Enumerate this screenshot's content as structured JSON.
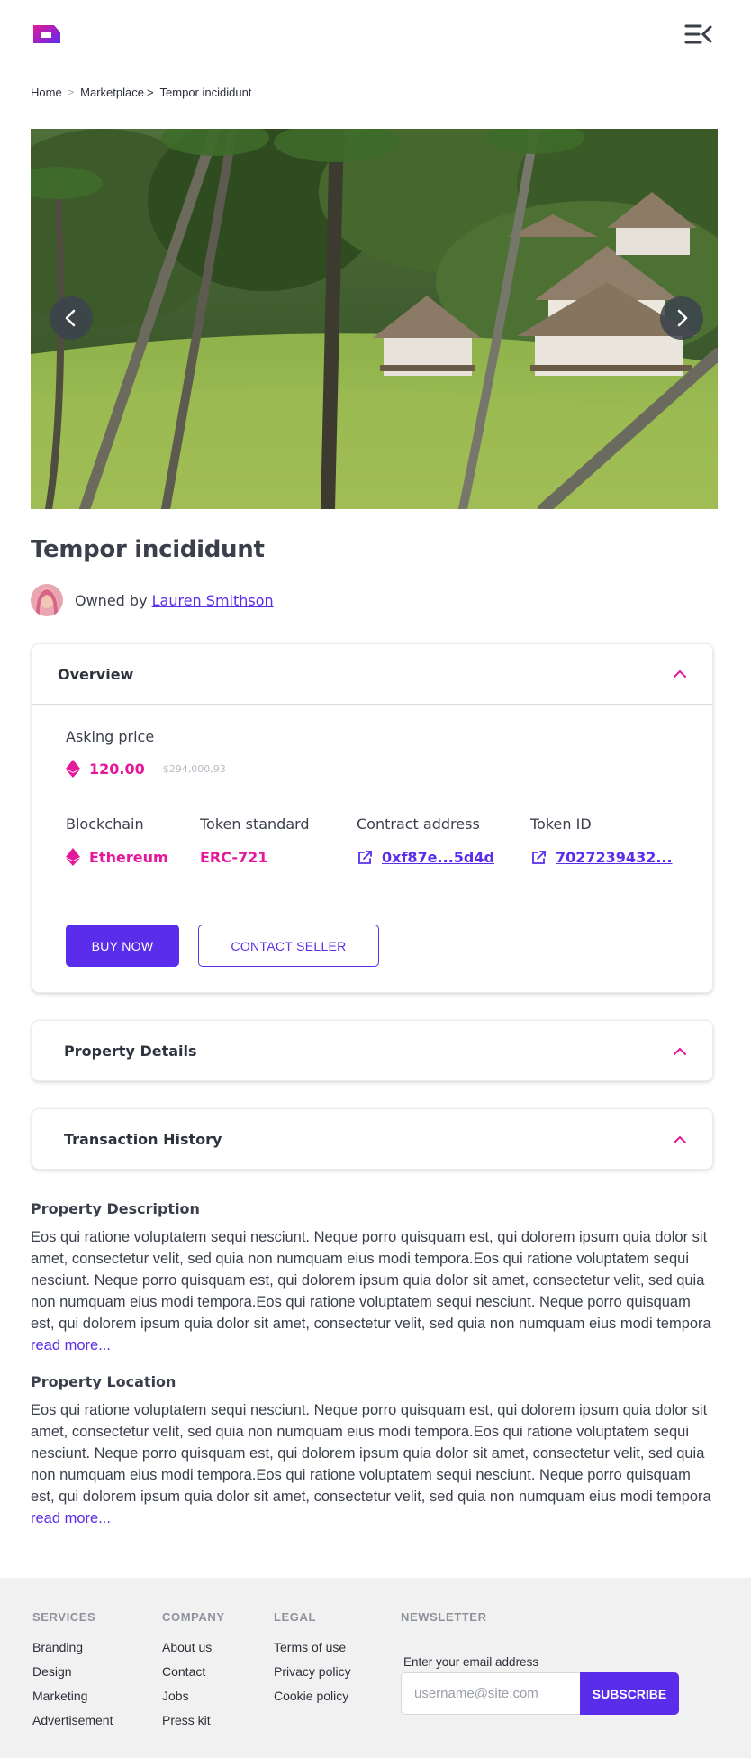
{
  "header": {
    "logo_icon": "brand-logo-icon",
    "menu_icon": "menu-collapse-icon"
  },
  "breadcrumb": {
    "items": [
      "Home",
      "Marketplace",
      "Tempor incididunt"
    ],
    "separator_1": ">",
    "separator_2": ">"
  },
  "gallery": {
    "prev_icon": "chevron-left-icon",
    "next_icon": "chevron-right-icon"
  },
  "property": {
    "title": "Tempor incididunt",
    "owned_by_label": "Owned by",
    "owner_name": "Lauren Smithson"
  },
  "overview": {
    "heading": "Overview",
    "asking_price_label": "Asking price",
    "price": "120.00",
    "price_usd": "$294,000,93",
    "blockchain_label": "Blockchain",
    "blockchain_value": "Ethereum",
    "token_standard_label": "Token standard",
    "token_standard_value": "ERC-721",
    "contract_address_label": "Contract address",
    "contract_address_value": "0xf87e...5d4d",
    "token_id_label": "Token ID",
    "token_id_value": "7027239432...",
    "buy_button": "BUY NOW",
    "contact_button": "CONTACT SELLER"
  },
  "accordions": {
    "details_heading": "Property Details",
    "history_heading": "Transaction History"
  },
  "description": {
    "heading": "Property Description",
    "text": "Eos qui ratione voluptatem sequi nesciunt. Neque porro quisquam est, qui dolorem ipsum quia dolor sit amet, consectetur velit, sed quia non numquam eius modi tempora.Eos qui ratione voluptatem sequi nesciunt. Neque porro quisquam est, qui dolorem ipsum quia dolor sit amet, consectetur velit, sed quia non numquam eius modi tempora.Eos qui ratione voluptatem sequi nesciunt. Neque porro quisquam est, qui dolorem ipsum quia dolor sit amet, consectetur velit, sed quia non numquam eius modi tempora",
    "read_more": "read more..."
  },
  "location": {
    "heading": "Property Location",
    "text": "Eos qui ratione voluptatem sequi nesciunt. Neque porro quisquam est, qui dolorem ipsum quia dolor sit amet, consectetur velit, sed quia non numquam eius modi tempora.Eos qui ratione voluptatem sequi nesciunt. Neque porro quisquam est, qui dolorem ipsum quia dolor sit amet, consectetur velit, sed quia non numquam eius modi tempora.Eos qui ratione voluptatem sequi nesciunt. Neque porro quisquam est, qui dolorem ipsum quia dolor sit amet, consectetur velit, sed quia non numquam eius modi tempora",
    "read_more": "read more..."
  },
  "footer": {
    "services": {
      "heading": "SERVICES",
      "links": [
        "Branding",
        "Design",
        "Marketing",
        "Advertisement"
      ]
    },
    "company": {
      "heading": "COMPANY",
      "links": [
        "About us",
        "Contact",
        "Jobs",
        "Press kit"
      ]
    },
    "legal": {
      "heading": "LEGAL",
      "links": [
        "Terms of use",
        "Privacy policy",
        "Cookie policy"
      ]
    },
    "newsletter": {
      "heading": "NEWSLETTER",
      "label": "Enter your email address",
      "placeholder": "username@site.com",
      "button": "SUBSCRIBE"
    }
  },
  "colors": {
    "primary": "#5a2dea",
    "accent": "#e5179b",
    "text": "#3a3f4b",
    "footer_bg": "#f1f1f2"
  }
}
